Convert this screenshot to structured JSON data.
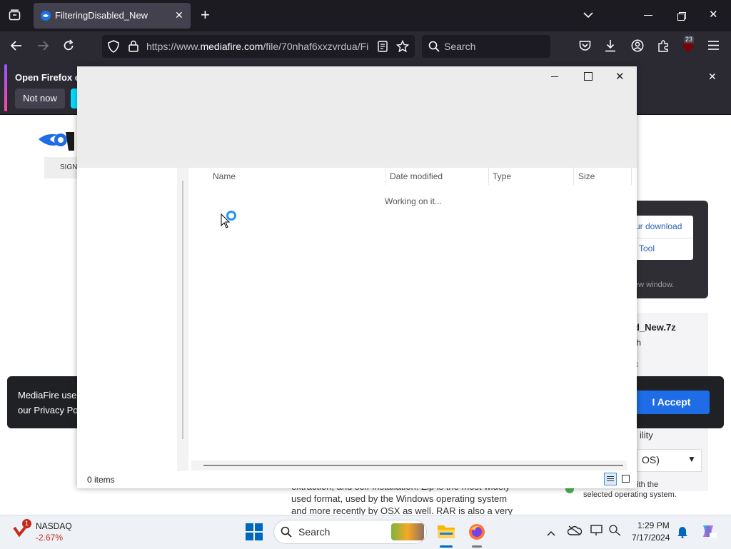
{
  "browser": {
    "tab_title": "FilteringDisabled_New",
    "url_prefix": "https://www.",
    "url_domain": "mediafire.com",
    "url_rest": "/file/70nhaf6xxzvrdua/Fi",
    "search_placeholder": "Search",
    "extension_badge": "23"
  },
  "notification": {
    "text": "Open Firefox ev",
    "not_now": "Not now"
  },
  "page": {
    "sign_label": "SIGN",
    "download_link": "ur download",
    "tool_link": "Tool",
    "window_note": "ew window.",
    "file_name": "d_New.7z",
    "file_with": "th",
    "file_c": "c",
    "compat_label": "ility",
    "os_select": "OS)",
    "compat_note_1": "e with the",
    "compat_note_2": "selected operating system.",
    "body_text": "extraction, and self-installation. Zip is the most widely used format, used by the Windows operating system and more recently by OSX as well. RAR is also a very"
  },
  "cookie": {
    "line1": "MediaFire use",
    "line2": "our Privacy Po",
    "accept": "I Accept"
  },
  "dialog": {
    "columns": [
      "Name",
      "Date modified",
      "Type",
      "Size"
    ],
    "working": "Working on it...",
    "item_count": "0 items"
  },
  "taskbar": {
    "ticker": "NASDAQ",
    "ticker_change": "-2.67%",
    "ticker_badge": "1",
    "search": "Search",
    "time": "1:29 PM",
    "date": "7/17/2024"
  }
}
